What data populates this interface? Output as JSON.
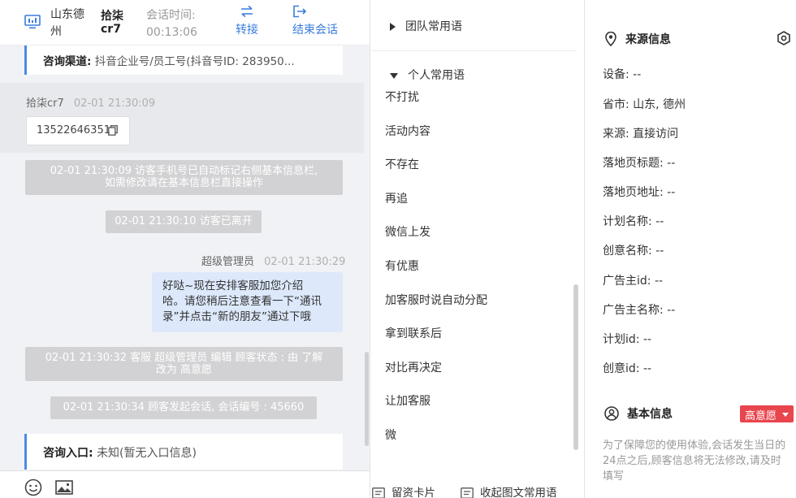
{
  "chat": {
    "location": "山东德州",
    "visitor_name": "拾柒cr7",
    "session_label": "会话时间:",
    "session_time": "00:13:06",
    "transfer_label": "转接",
    "end_label": "结束会话",
    "channel_label": "咨询渠道:",
    "channel_value": "抖音企业号/员工号(抖音号ID: 283950...",
    "visitor_msg": {
      "sender": "拾柒cr7",
      "time": "02-01 21:30:09",
      "text": "13522646351"
    },
    "system_msgs": [
      {
        "line1": "02-01 21:30:09 访客手机号已自动标记右侧基本信息栏,",
        "line2": "如需修改请在基本信息栏直接操作"
      },
      {
        "line1": "02-01 21:30:10 访客已离开",
        "line2": ""
      },
      {
        "line1": "02-01 21:30:32 客服 超级管理员 编辑 顾客状态 : 由 了解",
        "line2": "改为 高意愿"
      },
      {
        "line1": "02-01 21:30:34 顾客发起会话, 会话编号 : 45660",
        "line2": ""
      }
    ],
    "agent_msg": {
      "sender": "超级管理员",
      "time": "02-01 21:30:29",
      "line1": "好哒~现在安排客服加您介绍",
      "line2": "哈。请您稍后注意查看一下“通讯",
      "line3": "录”并点击“新的朋友”通过下哦"
    },
    "entry_label": "咨询入口:",
    "entry_value": "未知(暂无入口信息)"
  },
  "phrases": {
    "team_group": "团队常用语",
    "personal_group": "个人常用语",
    "items": [
      "不打扰",
      "活动内容",
      "不存在",
      "再追",
      "微信上发",
      "有优惠",
      "加客服时说自动分配",
      "拿到联系后",
      "对比再决定",
      "让加客服",
      "微"
    ],
    "footer_card": "留资卡片",
    "footer_collapse": "收起图文常用语"
  },
  "info": {
    "source_title": "来源信息",
    "fields": [
      {
        "label": "设备:",
        "value": "--"
      },
      {
        "label": "省市:",
        "value": "山东, 德州"
      },
      {
        "label": "来源:",
        "value": "直接访问"
      },
      {
        "label": "落地页标题:",
        "value": "--"
      },
      {
        "label": "落地页地址:",
        "value": "--"
      },
      {
        "label": "计划名称:",
        "value": "--"
      },
      {
        "label": "创意名称:",
        "value": "--"
      },
      {
        "label": "广告主id:",
        "value": "--"
      },
      {
        "label": "广告主名称:",
        "value": "--"
      },
      {
        "label": "计划id:",
        "value": "--"
      },
      {
        "label": "创意id:",
        "value": "--"
      }
    ],
    "basic_title": "基本信息",
    "intent_badge": "高意愿",
    "note": "为了保障您的使用体验,会话发生当日的24点之后,顾客信息将无法修改,请及时填写"
  },
  "colors": {
    "accent": "#3a7cdc",
    "badge": "#e9454e",
    "system_bubble": "#d2d2d4",
    "agent_bubble": "#dde9fb"
  },
  "icons": [
    "monitor-icon",
    "transfer-icon",
    "exit-icon",
    "copy-icon",
    "emoji-icon",
    "image-icon",
    "card-icon",
    "collapse-icon",
    "location-pin-icon",
    "settings-icon",
    "user-circle-icon"
  ]
}
